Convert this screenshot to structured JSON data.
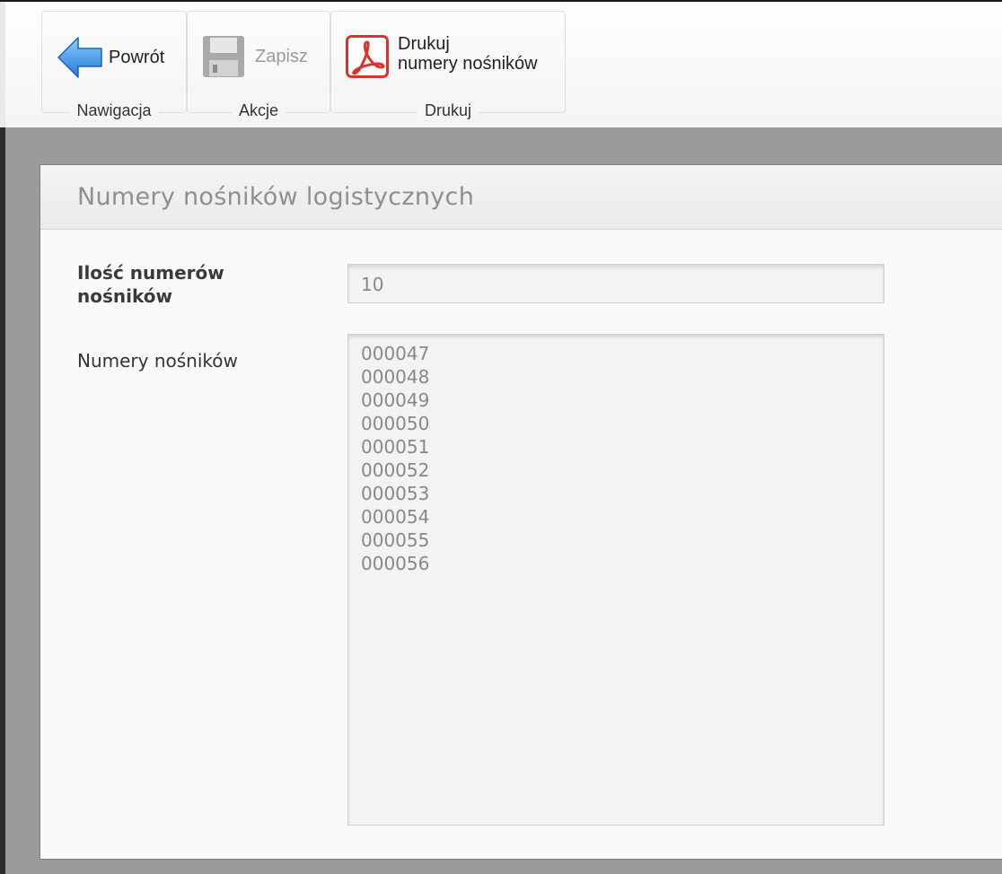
{
  "toolbar": {
    "groups": [
      {
        "caption": "Nawigacja",
        "buttons": [
          {
            "label": "Powrót",
            "icon": "arrow-left-icon",
            "enabled": true
          }
        ]
      },
      {
        "caption": "Akcje",
        "buttons": [
          {
            "label": "Zapisz",
            "icon": "floppy-disk-icon",
            "enabled": false
          }
        ]
      },
      {
        "caption": "Drukuj",
        "buttons": [
          {
            "label_line1": "Drukuj",
            "label_line2": "numery nośników",
            "icon": "pdf-icon",
            "enabled": true
          }
        ]
      }
    ]
  },
  "panel": {
    "title": "Numery nośników logistycznych",
    "fields": {
      "count": {
        "label_line1": "Ilość numerów",
        "label_line2": "nośników",
        "value": "10"
      },
      "numbers": {
        "label": "Numery nośników",
        "values": [
          "000047",
          "000048",
          "000049",
          "000050",
          "000051",
          "000052",
          "000053",
          "000054",
          "000055",
          "000056"
        ]
      }
    }
  },
  "colors": {
    "accent_blue": "#2e8fe0",
    "pdf_red": "#d9342b",
    "background": "#9b9b9b"
  }
}
